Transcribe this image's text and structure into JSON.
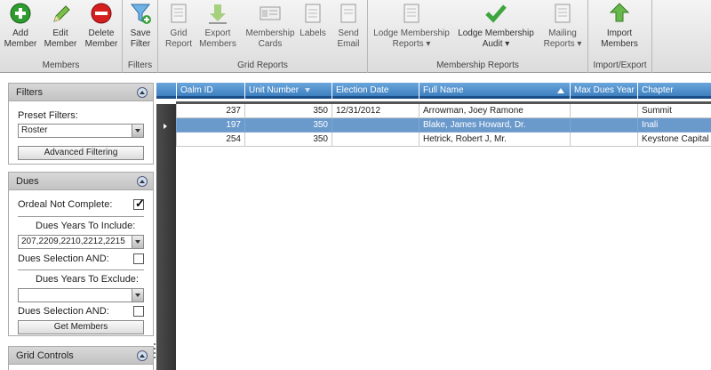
{
  "ribbon": {
    "groups": {
      "members": "Members",
      "filters": "Filters",
      "grid_reports": "Grid Reports",
      "membership_reports": "Membership Reports",
      "import_export": "Import/Export"
    },
    "buttons": {
      "add_member": "Add Member",
      "edit_member": "Edit Member",
      "delete_member": "Delete Member",
      "save_filter": "Save Filter",
      "grid_report": "Grid Report",
      "export_members": "Export Members",
      "membership_cards": "Membership Cards",
      "labels": "Labels",
      "send_email": "Send Email",
      "lodge_membership_reports": "Lodge Membership Reports ▾",
      "lodge_membership_audit": "Lodge Membership Audit ▾",
      "mailing_reports": "Mailing Reports ▾",
      "import_members": "Import Members"
    }
  },
  "filters_panel": {
    "title": "Filters",
    "preset_label": "Preset Filters:",
    "preset_value": "Roster",
    "advanced_button": "Advanced Filtering"
  },
  "dues_panel": {
    "title": "Dues",
    "ordeal_label": "Ordeal Not Complete:",
    "ordeal_checked": true,
    "years_include_label": "Dues Years To Include:",
    "years_include_value": "207,2209,2210,2212,2215",
    "selection_and_label_1": "Dues Selection AND:",
    "years_exclude_label": "Dues Years To Exclude:",
    "years_exclude_value": "",
    "selection_and_label_2": "Dues Selection AND:",
    "get_members_button": "Get Members"
  },
  "grid_controls_panel": {
    "title": "Grid Controls"
  },
  "grid": {
    "columns": [
      "Oalm ID",
      "Unit Number",
      "Election Date",
      "Full Name",
      "Max Dues Year",
      "Chapter"
    ],
    "rows": [
      [
        "237",
        "350",
        "12/31/2012",
        "Arrowman, Joey Ramone",
        "",
        "Summit"
      ],
      [
        "197",
        "350",
        "",
        "Blake, James Howard, Dr.",
        "",
        "Inali"
      ],
      [
        "254",
        "350",
        "",
        "Hetrick, Robert J, Mr.",
        "",
        "Keystone Capital"
      ]
    ],
    "selected_row": 1,
    "header_color": "#4a8ccc",
    "selected_color": "#6a99cc"
  }
}
